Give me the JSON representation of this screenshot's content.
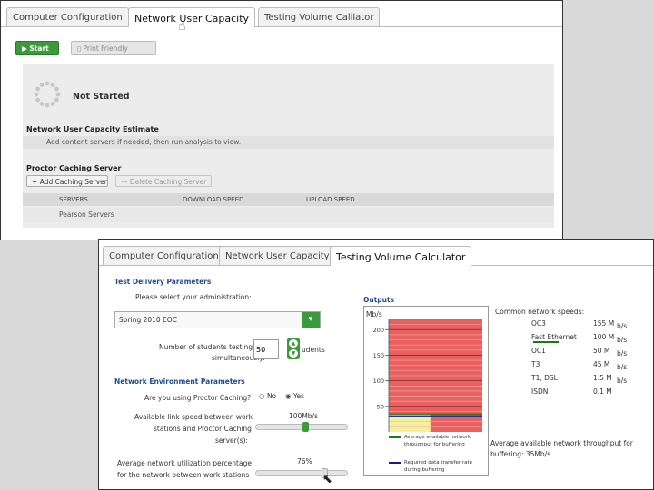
{
  "window1": {
    "tabs": [
      "Computer Configuration",
      "Network User Capacity",
      "Testing Volume Calculator"
    ],
    "tab3_visible": "Testing Volume Calilator",
    "start_label": "Start",
    "print_label": "Print Friendly",
    "status": "Not Started",
    "estimate_title": "Network User Capacity Estimate",
    "estimate_text": "Add content servers if needed, then run analysis to view.",
    "proctor_title": "Proctor Caching Server",
    "add_server_label": "Add Caching Server",
    "delete_server_label": "Delete Caching Server",
    "columns": [
      "SERVERS",
      "DOWNLOAD SPEED",
      "UPLOAD SPEED"
    ],
    "rows": [
      [
        "Pearson Servers",
        "",
        ""
      ]
    ]
  },
  "window2": {
    "tabs": [
      "Computer Configuration",
      "Network User Capacity",
      "Testing Volume Calculator"
    ],
    "test_delivery_title": "Test Delivery Parameters",
    "admin_prompt": "Please select your administration:",
    "admin_value": "Spring 2010 EOC",
    "students_label_1": "Number of students testing",
    "students_label_2": "simultaneously:",
    "students_value": "50",
    "students_suffix": "udents",
    "network_env_title": "Network Environment Parameters",
    "proctor_question": "Are you using Proctor Caching?",
    "proctor_options": [
      "No",
      "Yes"
    ],
    "proctor_selected": "Yes",
    "link_label": [
      "Available link speed between work",
      "stations and Proctor Caching",
      "server(s):"
    ],
    "link_value": "100Mb/s",
    "link_level": 0.55,
    "util_label": [
      "Average network utilization percentage",
      "for the network between work stations"
    ],
    "util_value": "76%",
    "util_level": 0.76,
    "outputs": {
      "title": "Outputs",
      "unit": "Mb/s",
      "yticks": [
        "200",
        "150",
        "100",
        "50"
      ],
      "legend": [
        {
          "color": "#1a7a1a",
          "text": "Average available network throughput for buffering"
        },
        {
          "color": "#1a1a8c",
          "text": "Required data transfer rate during buffering"
        }
      ]
    },
    "speeds_title": "Common network speeds:",
    "speeds": [
      {
        "name": "OC3",
        "value": "155 M",
        "unit": "b/s"
      },
      {
        "name": "Fast Ethernet",
        "value": "100 M",
        "unit": "b/s"
      },
      {
        "name": "OC1",
        "value": "50 M",
        "unit": "b/s"
      },
      {
        "name": "T3",
        "value": "45 M",
        "unit": "b/s"
      },
      {
        "name": "T1, DSL",
        "value": "1.5 M",
        "unit": "b/s"
      },
      {
        "name": "ISDN",
        "value": "0.1 M",
        "unit": ""
      }
    ],
    "throughput_text_1": "Average available network throughput for",
    "throughput_text_2": "buffering: 35Mb/s"
  },
  "chart_data": {
    "type": "bar",
    "yticks": [
      50,
      100,
      150,
      200
    ],
    "ylim": [
      0,
      220
    ],
    "lines": [
      {
        "name": "Average available network throughput for buffering",
        "value": 35,
        "color": "#1a7a1a"
      },
      {
        "name": "Required data transfer rate during buffering",
        "value": 35,
        "color": "#1a1a8c"
      }
    ]
  },
  "colors": {
    "green": "#3b9a3b",
    "red_zone": "#e86060",
    "yellow_zone": "#f5f0a0",
    "heading_blue": "#1f4f8f"
  }
}
